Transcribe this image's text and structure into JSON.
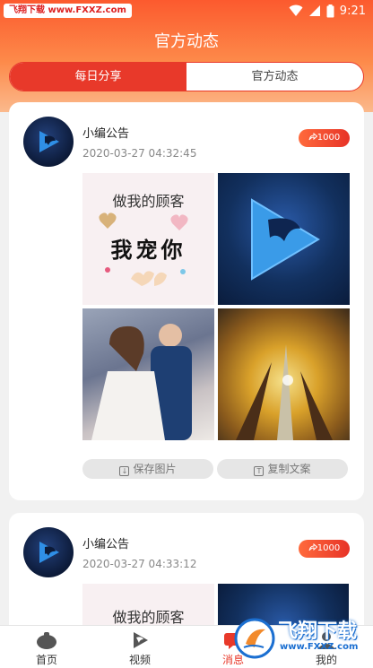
{
  "status_bar": {
    "watermark": "飞翔下载 www.FXXZ.com",
    "time": "9:21"
  },
  "page": {
    "title": "官方动态"
  },
  "tabs": [
    {
      "label": "每日分享",
      "active": true
    },
    {
      "label": "官方动态",
      "active": false
    }
  ],
  "posts": [
    {
      "author": "小编公告",
      "time": "2020-03-27 04:32:45",
      "share_count": "1000",
      "image_text": {
        "line1": "做我的顾客",
        "line2": "我宠你"
      },
      "actions": {
        "save": "保存图片",
        "copy": "复制文案"
      }
    },
    {
      "author": "小编公告",
      "time": "2020-03-27 04:33:12",
      "share_count": "1000",
      "image_text": {
        "line1": "做我的顾客"
      }
    }
  ],
  "bottom_nav": [
    {
      "label": "首页",
      "icon": "home-icon",
      "active": false
    },
    {
      "label": "视频",
      "icon": "video-icon",
      "active": false
    },
    {
      "label": "消息",
      "icon": "message-icon",
      "active": true
    },
    {
      "label": "我的",
      "icon": "profile-icon",
      "active": false
    }
  ],
  "watermark_corner": {
    "text": "飞翔下载",
    "sub": "www.FXXZ.com"
  },
  "colors": {
    "accent": "#e8392a",
    "header_top": "#fc5a2e",
    "header_bottom": "#fbb98c"
  }
}
